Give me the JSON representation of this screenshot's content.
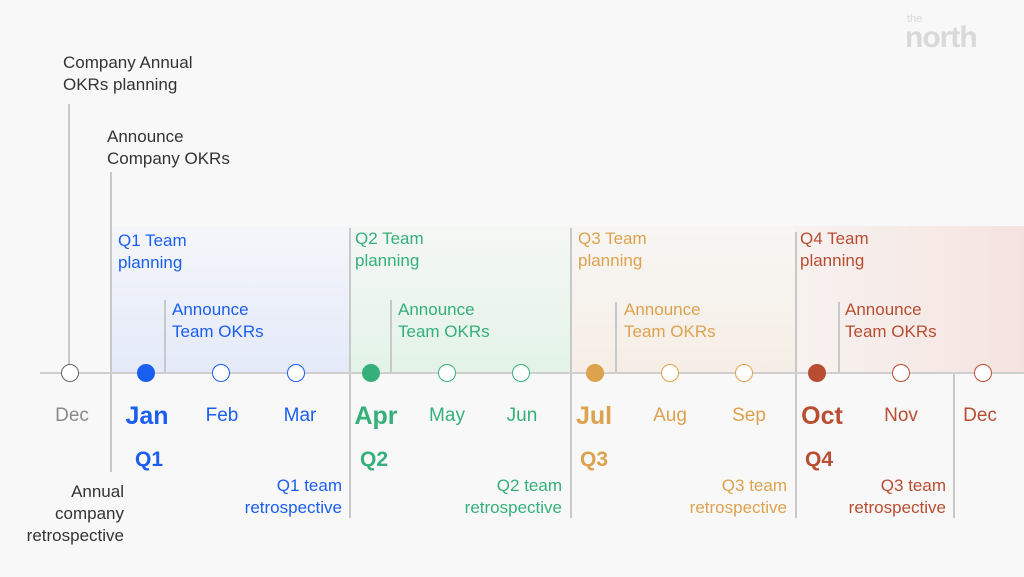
{
  "logo": {
    "small": "the",
    "large": "north"
  },
  "colors": {
    "neutral": "#333333",
    "muted": "#8a8a8a",
    "q1": "#1a5ef0",
    "q2": "#35b07a",
    "q3": "#dda24e",
    "q4": "#b84d31"
  },
  "company": {
    "annual_planning": [
      "Company Annual",
      "OKRs planning"
    ],
    "announce": [
      "Announce",
      "Company OKRs"
    ],
    "retrospective": [
      "Annual",
      "company",
      "retrospective"
    ]
  },
  "quarters": [
    {
      "id": "q1",
      "label": "Q1",
      "planning": [
        "Q1 Team",
        "planning"
      ],
      "announce": [
        "Announce",
        "Team  OKRs"
      ],
      "retro": [
        "Q1 team",
        "retrospective"
      ],
      "months": [
        "Jan",
        "Feb",
        "Mar"
      ]
    },
    {
      "id": "q2",
      "label": "Q2",
      "planning": [
        "Q2 Team",
        "planning"
      ],
      "announce": [
        "Announce",
        "Team  OKRs"
      ],
      "retro": [
        "Q2 team",
        "retrospective"
      ],
      "months": [
        "Apr",
        "May",
        "Jun"
      ]
    },
    {
      "id": "q3",
      "label": "Q3",
      "planning": [
        "Q3 Team",
        "planning"
      ],
      "announce": [
        "Announce",
        "Team  OKRs"
      ],
      "retro": [
        "Q3 team",
        "retrospective"
      ],
      "months": [
        "Jul",
        "Aug",
        "Sep"
      ]
    },
    {
      "id": "q4",
      "label": "Q4",
      "planning": [
        "Q4 Team",
        "planning"
      ],
      "announce": [
        "Announce",
        "Team  OKRs"
      ],
      "retro": [
        "Q3 team",
        "retrospective"
      ],
      "months": [
        "Oct",
        "Nov"
      ]
    }
  ],
  "edge_months": {
    "start": "Dec",
    "end": "Dec"
  }
}
